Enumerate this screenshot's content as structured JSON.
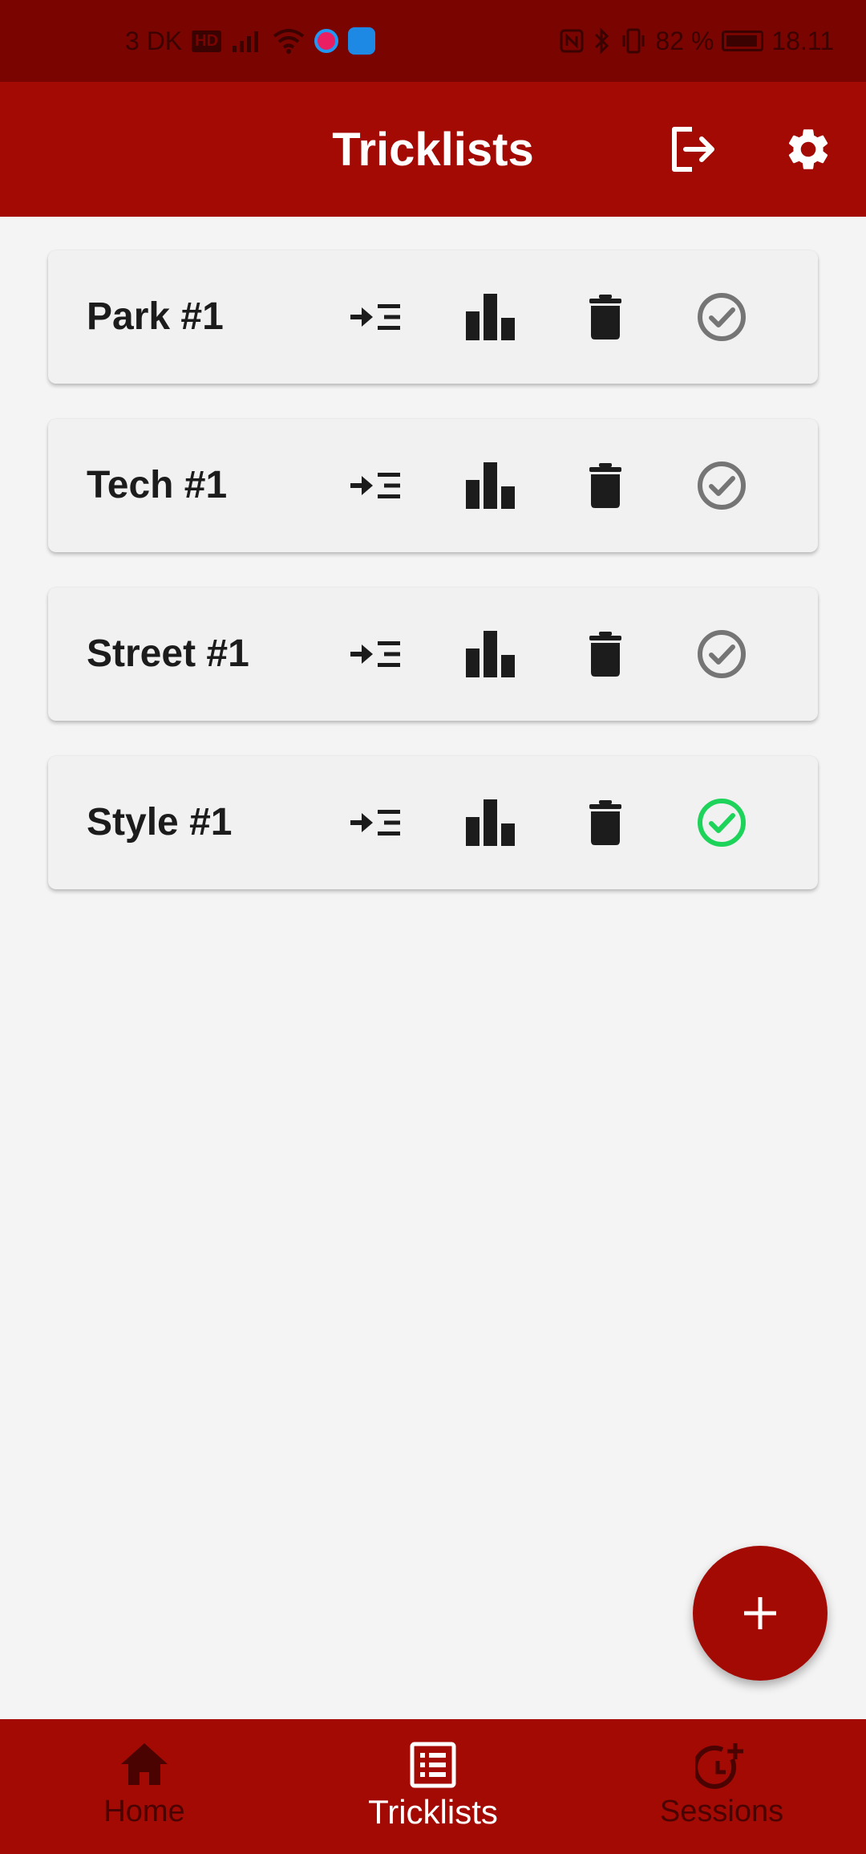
{
  "status_bar": {
    "carrier": "3 DK",
    "hd_badge": "HD",
    "battery_percent": "82 %",
    "time": "18.11"
  },
  "app_bar": {
    "title": "Tricklists",
    "logout_icon": "logout-icon",
    "settings_icon": "gear-icon"
  },
  "tricklists": [
    {
      "name": "Park #1",
      "completed": false
    },
    {
      "name": "Tech #1",
      "completed": false
    },
    {
      "name": "Street #1",
      "completed": false
    },
    {
      "name": "Style #1",
      "completed": true
    }
  ],
  "fab": {
    "icon": "plus-icon"
  },
  "bottom_nav": {
    "items": [
      {
        "label": "Home",
        "icon": "home-icon",
        "active": false
      },
      {
        "label": "Tricklists",
        "icon": "list-icon",
        "active": true
      },
      {
        "label": "Sessions",
        "icon": "session-clock-add-icon",
        "active": false
      }
    ]
  },
  "colors": {
    "primary": "#a30a04",
    "status_bar": "#7a0400",
    "background": "#f4f4f4",
    "card": "#f1f1f1",
    "check_inactive": "#757575",
    "check_active": "#1ed35a",
    "nav_inactive": "#4a0300"
  }
}
